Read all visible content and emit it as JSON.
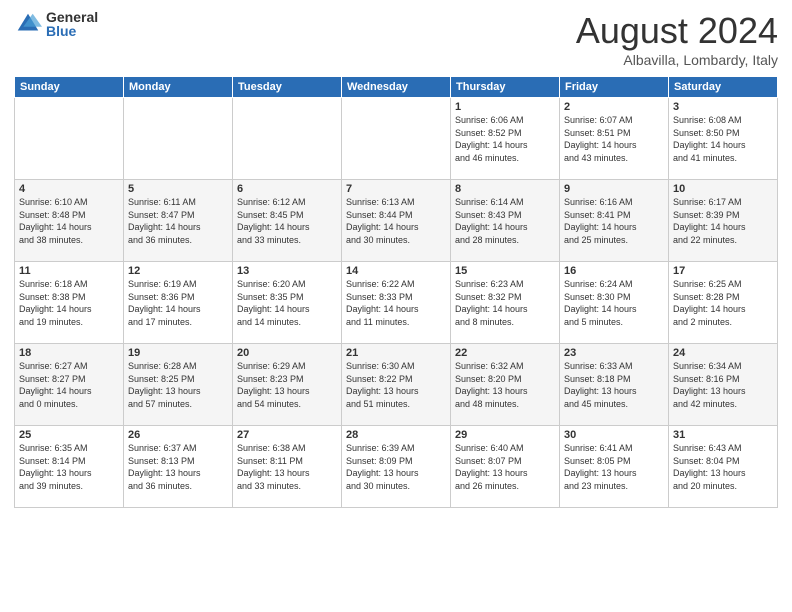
{
  "logo": {
    "general": "General",
    "blue": "Blue"
  },
  "header": {
    "month": "August 2024",
    "location": "Albavilla, Lombardy, Italy"
  },
  "weekdays": [
    "Sunday",
    "Monday",
    "Tuesday",
    "Wednesday",
    "Thursday",
    "Friday",
    "Saturday"
  ],
  "weeks": [
    [
      {
        "day": "",
        "info": ""
      },
      {
        "day": "",
        "info": ""
      },
      {
        "day": "",
        "info": ""
      },
      {
        "day": "",
        "info": ""
      },
      {
        "day": "1",
        "info": "Sunrise: 6:06 AM\nSunset: 8:52 PM\nDaylight: 14 hours\nand 46 minutes."
      },
      {
        "day": "2",
        "info": "Sunrise: 6:07 AM\nSunset: 8:51 PM\nDaylight: 14 hours\nand 43 minutes."
      },
      {
        "day": "3",
        "info": "Sunrise: 6:08 AM\nSunset: 8:50 PM\nDaylight: 14 hours\nand 41 minutes."
      }
    ],
    [
      {
        "day": "4",
        "info": "Sunrise: 6:10 AM\nSunset: 8:48 PM\nDaylight: 14 hours\nand 38 minutes."
      },
      {
        "day": "5",
        "info": "Sunrise: 6:11 AM\nSunset: 8:47 PM\nDaylight: 14 hours\nand 36 minutes."
      },
      {
        "day": "6",
        "info": "Sunrise: 6:12 AM\nSunset: 8:45 PM\nDaylight: 14 hours\nand 33 minutes."
      },
      {
        "day": "7",
        "info": "Sunrise: 6:13 AM\nSunset: 8:44 PM\nDaylight: 14 hours\nand 30 minutes."
      },
      {
        "day": "8",
        "info": "Sunrise: 6:14 AM\nSunset: 8:43 PM\nDaylight: 14 hours\nand 28 minutes."
      },
      {
        "day": "9",
        "info": "Sunrise: 6:16 AM\nSunset: 8:41 PM\nDaylight: 14 hours\nand 25 minutes."
      },
      {
        "day": "10",
        "info": "Sunrise: 6:17 AM\nSunset: 8:39 PM\nDaylight: 14 hours\nand 22 minutes."
      }
    ],
    [
      {
        "day": "11",
        "info": "Sunrise: 6:18 AM\nSunset: 8:38 PM\nDaylight: 14 hours\nand 19 minutes."
      },
      {
        "day": "12",
        "info": "Sunrise: 6:19 AM\nSunset: 8:36 PM\nDaylight: 14 hours\nand 17 minutes."
      },
      {
        "day": "13",
        "info": "Sunrise: 6:20 AM\nSunset: 8:35 PM\nDaylight: 14 hours\nand 14 minutes."
      },
      {
        "day": "14",
        "info": "Sunrise: 6:22 AM\nSunset: 8:33 PM\nDaylight: 14 hours\nand 11 minutes."
      },
      {
        "day": "15",
        "info": "Sunrise: 6:23 AM\nSunset: 8:32 PM\nDaylight: 14 hours\nand 8 minutes."
      },
      {
        "day": "16",
        "info": "Sunrise: 6:24 AM\nSunset: 8:30 PM\nDaylight: 14 hours\nand 5 minutes."
      },
      {
        "day": "17",
        "info": "Sunrise: 6:25 AM\nSunset: 8:28 PM\nDaylight: 14 hours\nand 2 minutes."
      }
    ],
    [
      {
        "day": "18",
        "info": "Sunrise: 6:27 AM\nSunset: 8:27 PM\nDaylight: 14 hours\nand 0 minutes."
      },
      {
        "day": "19",
        "info": "Sunrise: 6:28 AM\nSunset: 8:25 PM\nDaylight: 13 hours\nand 57 minutes."
      },
      {
        "day": "20",
        "info": "Sunrise: 6:29 AM\nSunset: 8:23 PM\nDaylight: 13 hours\nand 54 minutes."
      },
      {
        "day": "21",
        "info": "Sunrise: 6:30 AM\nSunset: 8:22 PM\nDaylight: 13 hours\nand 51 minutes."
      },
      {
        "day": "22",
        "info": "Sunrise: 6:32 AM\nSunset: 8:20 PM\nDaylight: 13 hours\nand 48 minutes."
      },
      {
        "day": "23",
        "info": "Sunrise: 6:33 AM\nSunset: 8:18 PM\nDaylight: 13 hours\nand 45 minutes."
      },
      {
        "day": "24",
        "info": "Sunrise: 6:34 AM\nSunset: 8:16 PM\nDaylight: 13 hours\nand 42 minutes."
      }
    ],
    [
      {
        "day": "25",
        "info": "Sunrise: 6:35 AM\nSunset: 8:14 PM\nDaylight: 13 hours\nand 39 minutes."
      },
      {
        "day": "26",
        "info": "Sunrise: 6:37 AM\nSunset: 8:13 PM\nDaylight: 13 hours\nand 36 minutes."
      },
      {
        "day": "27",
        "info": "Sunrise: 6:38 AM\nSunset: 8:11 PM\nDaylight: 13 hours\nand 33 minutes."
      },
      {
        "day": "28",
        "info": "Sunrise: 6:39 AM\nSunset: 8:09 PM\nDaylight: 13 hours\nand 30 minutes."
      },
      {
        "day": "29",
        "info": "Sunrise: 6:40 AM\nSunset: 8:07 PM\nDaylight: 13 hours\nand 26 minutes."
      },
      {
        "day": "30",
        "info": "Sunrise: 6:41 AM\nSunset: 8:05 PM\nDaylight: 13 hours\nand 23 minutes."
      },
      {
        "day": "31",
        "info": "Sunrise: 6:43 AM\nSunset: 8:04 PM\nDaylight: 13 hours\nand 20 minutes."
      }
    ]
  ]
}
